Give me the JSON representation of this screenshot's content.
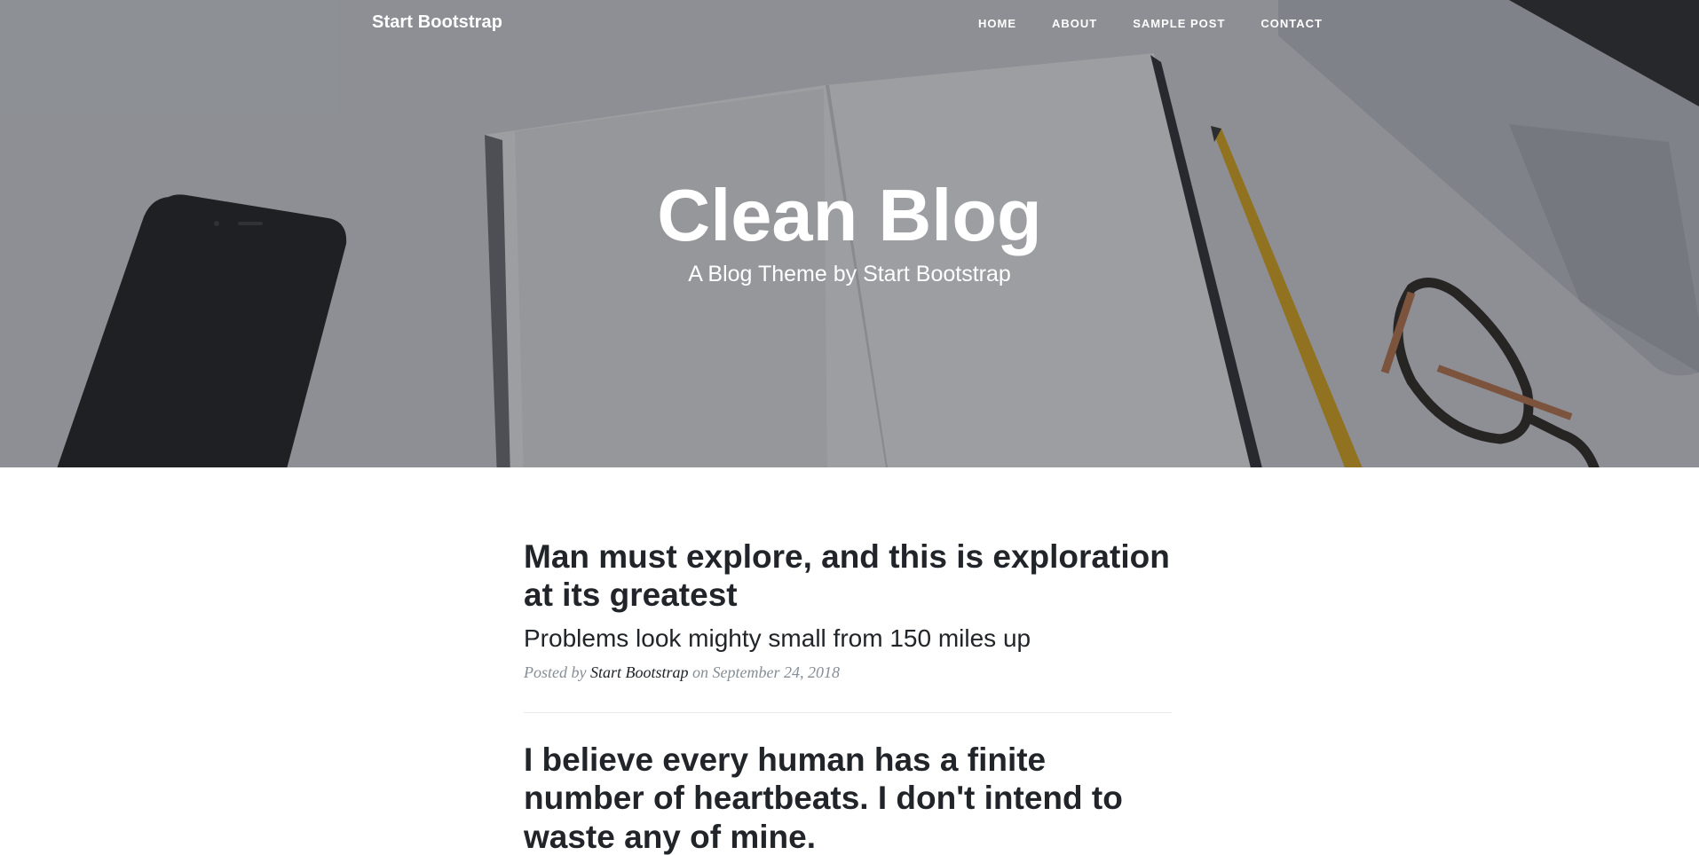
{
  "nav": {
    "brand": "Start Bootstrap",
    "links": [
      "Home",
      "About",
      "Sample Post",
      "Contact"
    ]
  },
  "hero": {
    "title": "Clean Blog",
    "subtitle": "A Blog Theme by Start Bootstrap"
  },
  "posts": [
    {
      "title": "Man must explore, and this is exploration at its greatest",
      "subtitle": "Problems look mighty small from 150 miles up",
      "meta_prefix": "Posted by",
      "author": "Start Bootstrap",
      "meta_suffix": "on September 24, 2018"
    },
    {
      "title": "I believe every human has a finite number of heartbeats. I don't intend to waste any of mine."
    }
  ],
  "colors": {
    "text": "#212529",
    "meta": "#868e96",
    "divider": "#e9ecef"
  }
}
